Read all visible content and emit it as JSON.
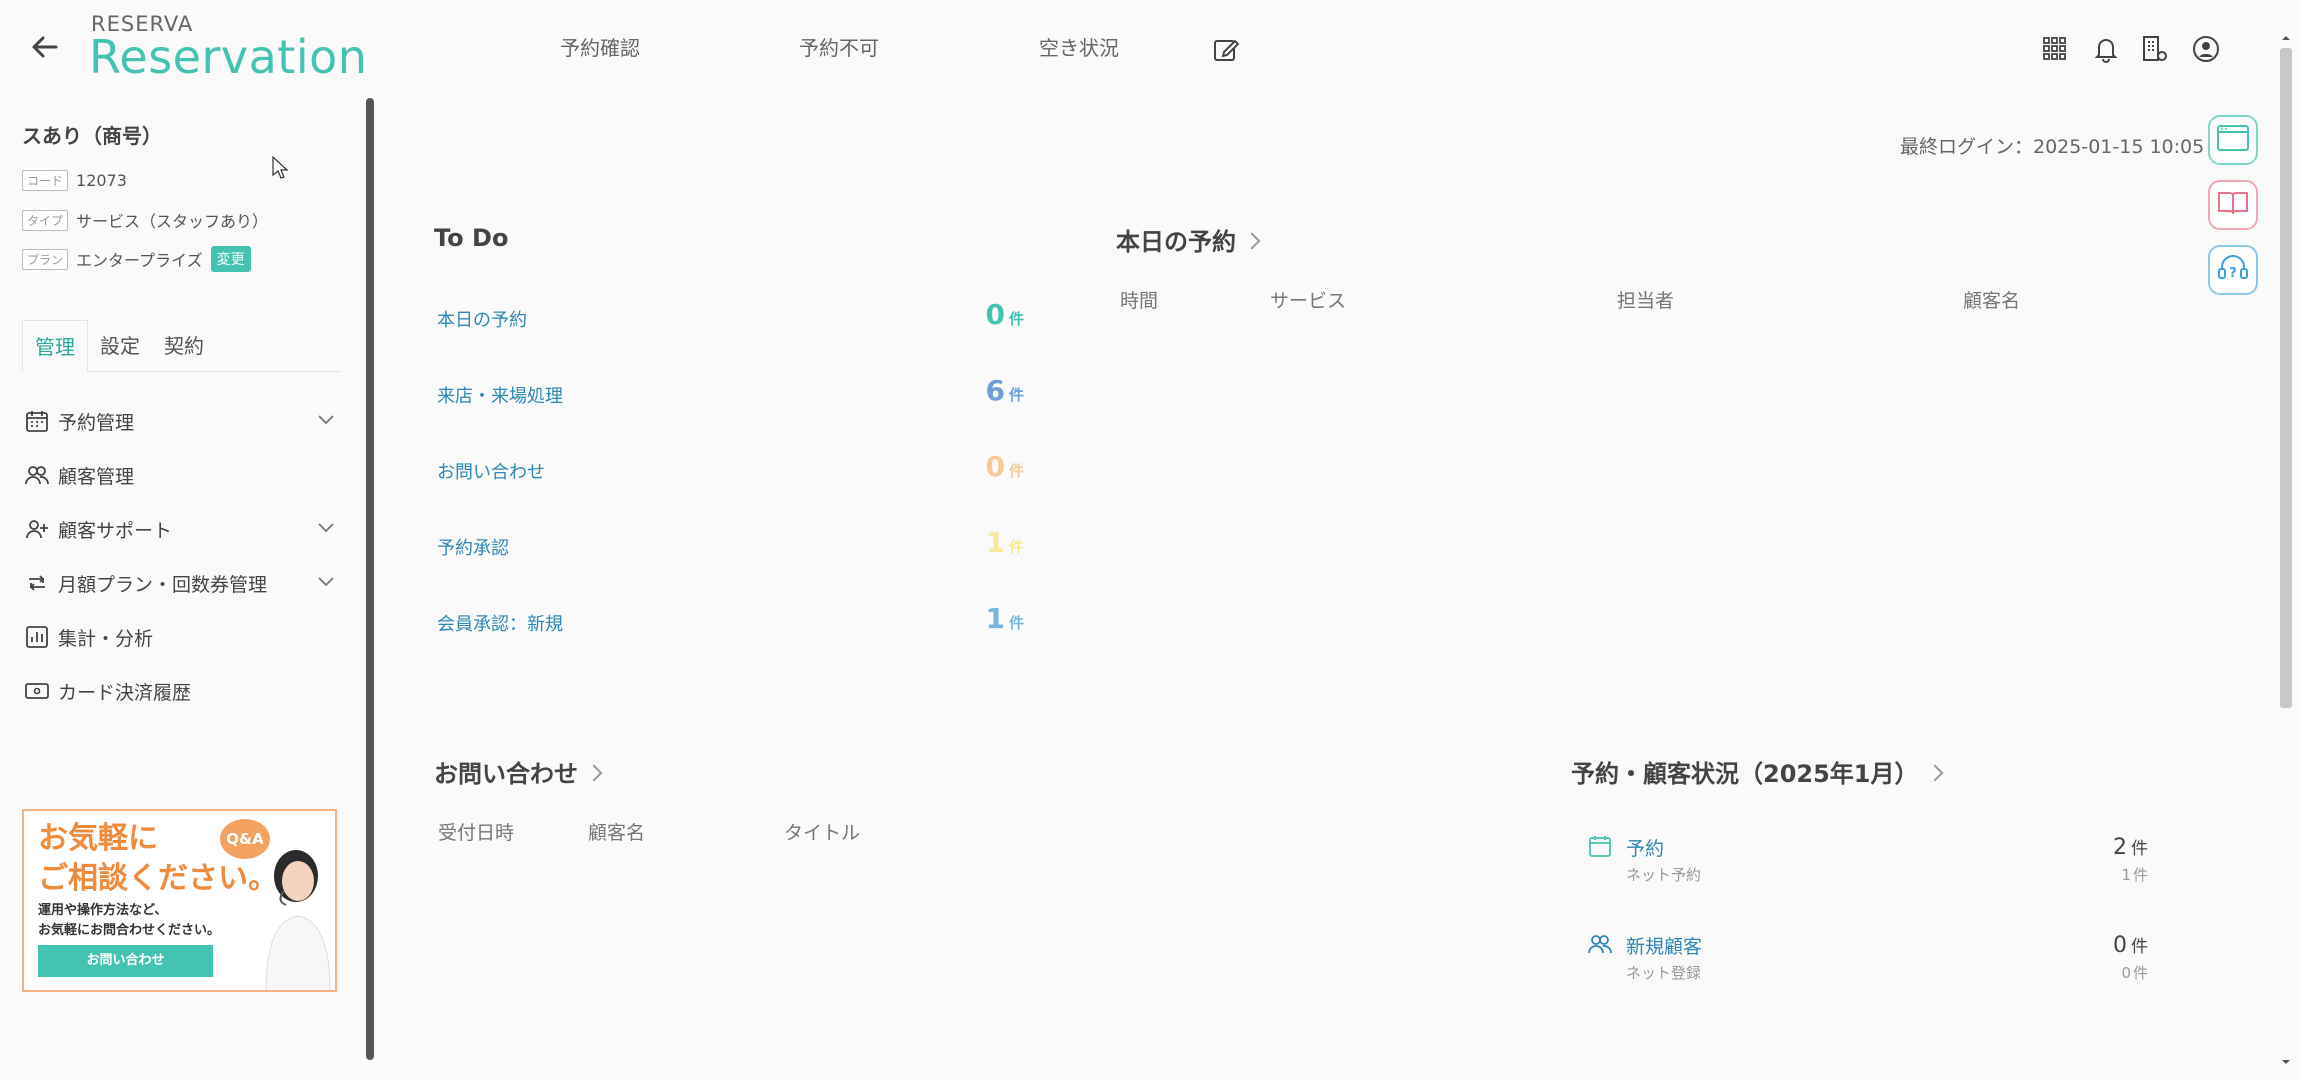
{
  "header": {
    "brand_small": "RESERVA",
    "brand_big": "Reservation",
    "nav": [
      "予約確認",
      "予約不可",
      "空き状況"
    ]
  },
  "sidebar": {
    "shop_name": "スあり（商号）",
    "code_tag": "コード",
    "code_value": "12073",
    "type_tag": "タイプ",
    "type_value": "サービス（スタッフあり）",
    "plan_tag": "プラン",
    "plan_value": "エンタープライズ",
    "change_label": "変更",
    "tabs": [
      "管理",
      "設定",
      "契約"
    ],
    "menu": [
      {
        "label": "予約管理",
        "icon": "calendar-icon"
      },
      {
        "label": "顧客管理",
        "icon": "users-icon"
      },
      {
        "label": "顧客サポート",
        "icon": "user-plus-icon"
      },
      {
        "label": "月額プラン・回数券管理",
        "icon": "repeat-icon"
      },
      {
        "label": "集計・分析",
        "icon": "chart-icon"
      },
      {
        "label": "カード決済履歴",
        "icon": "card-icon"
      }
    ],
    "banner": {
      "title_line1": "お気軽に",
      "title_line2": "ご相談ください。",
      "qa": "Q&A",
      "sub_line1": "運用や操作方法など、",
      "sub_line2": "お気軽にお問合わせください。",
      "button": "お問い合わせ"
    }
  },
  "main": {
    "last_login": "最終ログイン：2025-01-15 10:05",
    "todo": {
      "title": "To Do",
      "unit": "件",
      "items": [
        {
          "label": "本日の予約",
          "count": "0",
          "color": "#44c3b3"
        },
        {
          "label": "来店・来場処理",
          "count": "6",
          "color": "#6f9fd8"
        },
        {
          "label": "お問い合わせ",
          "count": "0",
          "color": "#f5c99a"
        },
        {
          "label": "予約承認",
          "count": "1",
          "color": "#f7e89a"
        },
        {
          "label": "会員承認：新規",
          "count": "1",
          "color": "#78b5d8"
        }
      ]
    },
    "today": {
      "title": "本日の予約",
      "columns": [
        "時間",
        "サービス",
        "担当者",
        "顧客名"
      ]
    },
    "inquiry": {
      "title": "お問い合わせ",
      "columns": [
        "受付日時",
        "顧客名",
        "タイトル"
      ]
    },
    "status": {
      "title": "予約・顧客状況（2025年1月）",
      "rows": [
        {
          "label": "予約",
          "sub": "ネット予約",
          "num": "2",
          "num_sub": "1",
          "unit": "件"
        },
        {
          "label": "新規顧客",
          "sub": "ネット登録",
          "num": "0",
          "num_sub": "0",
          "unit": "件"
        }
      ]
    }
  }
}
